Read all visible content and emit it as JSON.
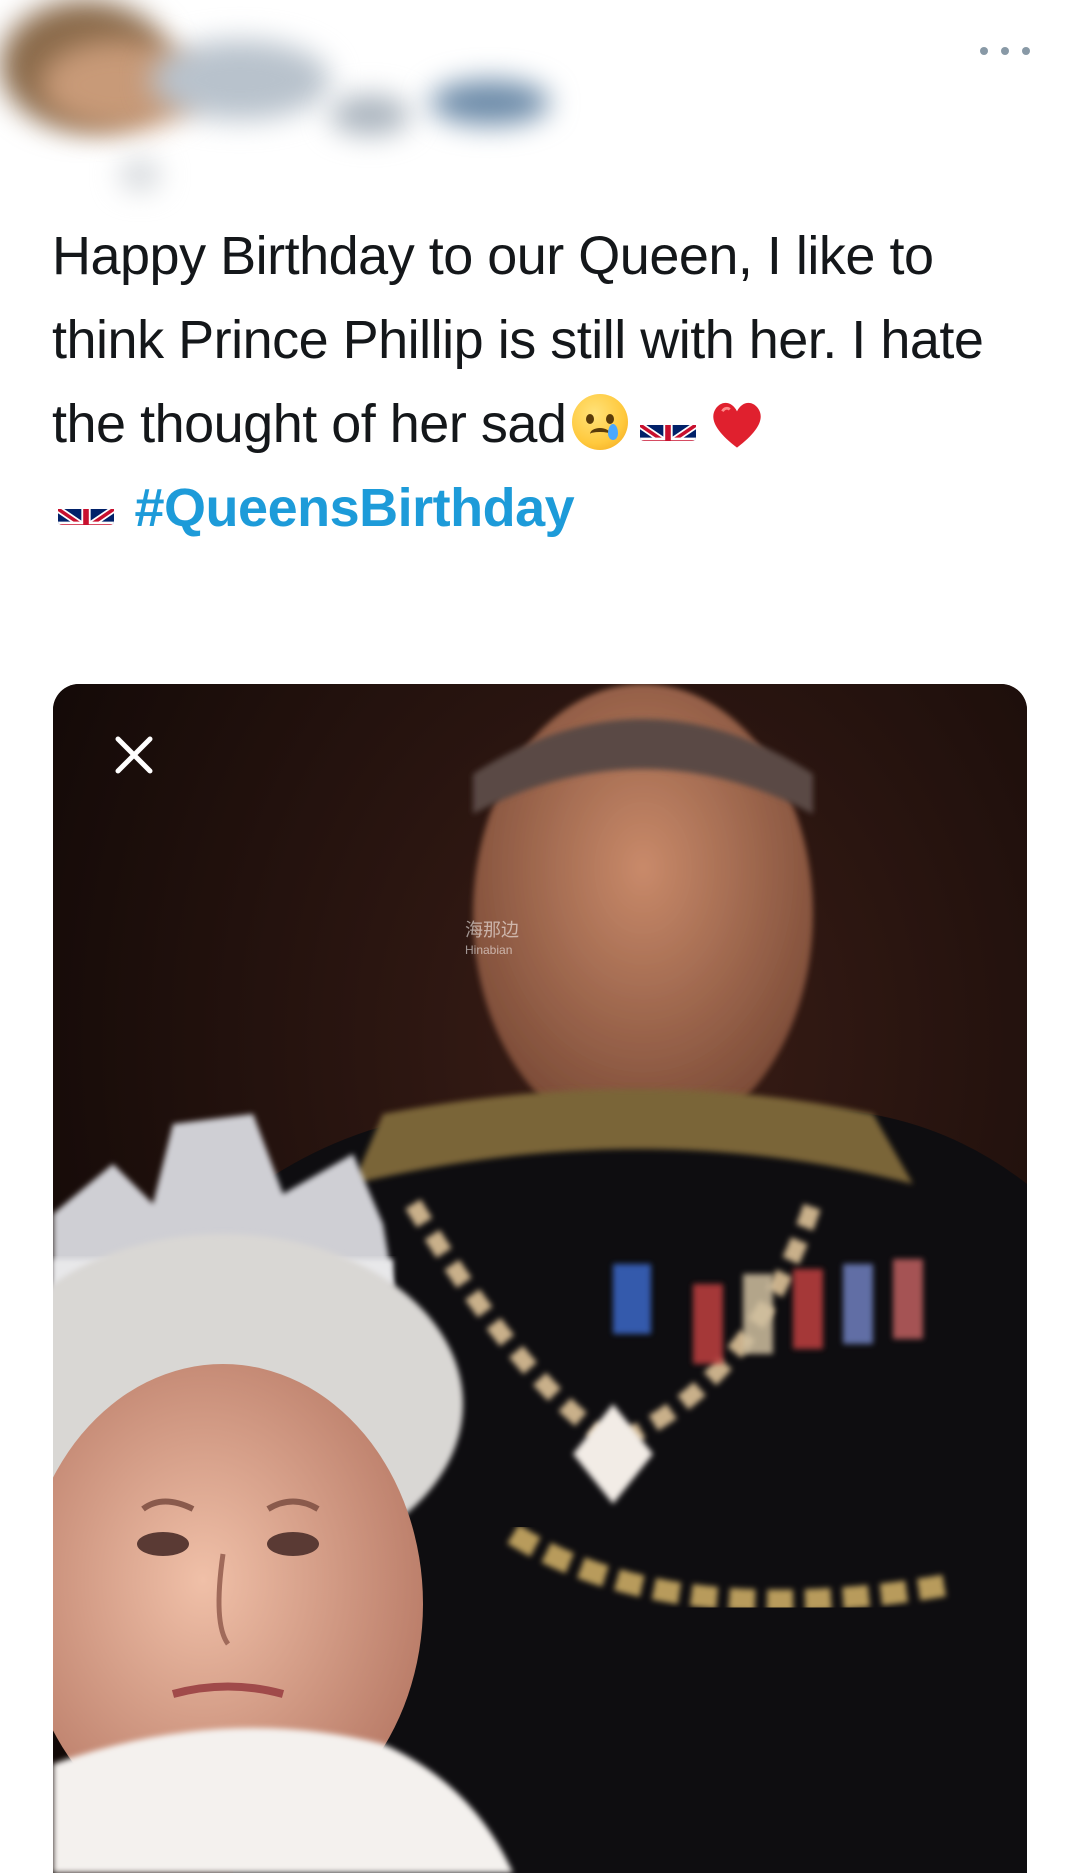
{
  "header": {
    "more_icon": "more-horizontal-icon"
  },
  "tweet": {
    "text_part1": "Happy Birthday to our Queen, I like to think Prince Phillip is still with her. I hate the thought of her sad",
    "emojis": [
      "crying-face",
      "uk-flag",
      "red-heart",
      "uk-flag"
    ],
    "hashtag": "#QueensBirthday",
    "hashtag_color": "#1d9bd9"
  },
  "media": {
    "close_icon": "close-icon",
    "watermark_main": "海那边",
    "watermark_sub": "Hinabian"
  }
}
